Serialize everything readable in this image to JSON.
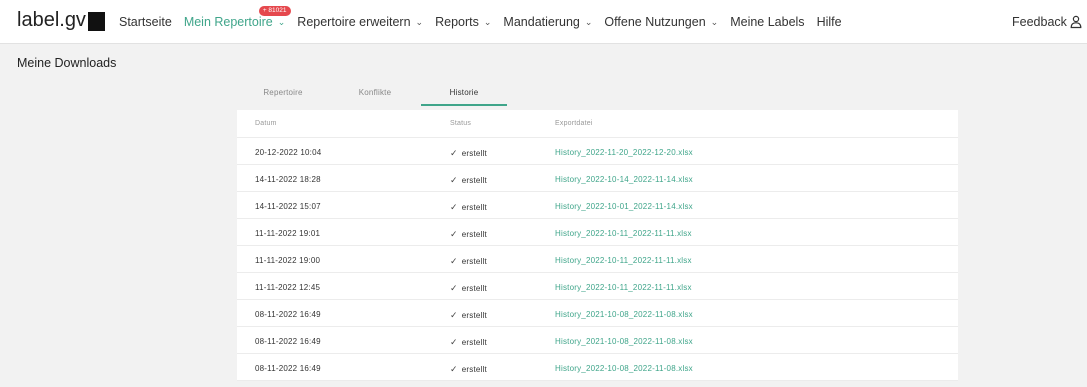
{
  "header": {
    "logo_text": "label.gv",
    "nav": [
      {
        "label": "Startseite",
        "dropdown": false,
        "active": false
      },
      {
        "label": "Mein Repertoire",
        "dropdown": true,
        "active": true,
        "badge": "+ 81021"
      },
      {
        "label": "Repertoire erweitern",
        "dropdown": true,
        "active": false
      },
      {
        "label": "Reports",
        "dropdown": true,
        "active": false
      },
      {
        "label": "Mandatierung",
        "dropdown": true,
        "active": false
      },
      {
        "label": "Offene Nutzungen",
        "dropdown": true,
        "active": false
      },
      {
        "label": "Meine Labels",
        "dropdown": false,
        "active": false
      },
      {
        "label": "Hilfe",
        "dropdown": false,
        "active": false
      }
    ],
    "feedback_label": "Feedback",
    "user_icon": "user-icon"
  },
  "page": {
    "title": "Meine Downloads"
  },
  "tabs": [
    {
      "label": "Repertoire",
      "active": false
    },
    {
      "label": "Konflikte",
      "active": false
    },
    {
      "label": "Historie",
      "active": true
    }
  ],
  "table": {
    "columns": [
      "Datum",
      "Status",
      "Exportdatei"
    ],
    "rows": [
      {
        "date": "20-12-2022 10:04",
        "status": "erstellt",
        "file": "History_2022-11-20_2022-12-20.xlsx"
      },
      {
        "date": "14-11-2022 18:28",
        "status": "erstellt",
        "file": "History_2022-10-14_2022-11-14.xlsx"
      },
      {
        "date": "14-11-2022 15:07",
        "status": "erstellt",
        "file": "History_2022-10-01_2022-11-14.xlsx"
      },
      {
        "date": "11-11-2022 19:01",
        "status": "erstellt",
        "file": "History_2022-10-11_2022-11-11.xlsx"
      },
      {
        "date": "11-11-2022 19:00",
        "status": "erstellt",
        "file": "History_2022-10-11_2022-11-11.xlsx"
      },
      {
        "date": "11-11-2022 12:45",
        "status": "erstellt",
        "file": "History_2022-10-11_2022-11-11.xlsx"
      },
      {
        "date": "08-11-2022 16:49",
        "status": "erstellt",
        "file": "History_2021-10-08_2022-11-08.xlsx"
      },
      {
        "date": "08-11-2022 16:49",
        "status": "erstellt",
        "file": "History_2021-10-08_2022-11-08.xlsx"
      },
      {
        "date": "08-11-2022 16:49",
        "status": "erstellt",
        "file": "History_2022-10-08_2022-11-08.xlsx"
      }
    ]
  },
  "colors": {
    "accent": "#3fa58a",
    "badge": "#e5484d"
  }
}
